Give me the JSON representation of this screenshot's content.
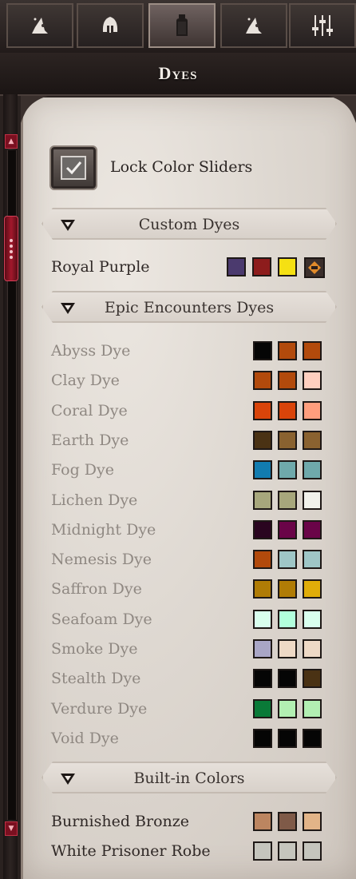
{
  "header": {
    "title": "Dyes"
  },
  "tabs": [
    {
      "icon": "wizard-hat-icon"
    },
    {
      "icon": "helmet-icon"
    },
    {
      "icon": "dye-bottle-icon",
      "active": true
    },
    {
      "icon": "wizard-hat-icon"
    },
    {
      "icon": "sliders-icon"
    }
  ],
  "lock": {
    "label": "Lock Color Sliders",
    "checked": true
  },
  "sections": {
    "custom": "Custom Dyes",
    "epic": "Epic Encounters Dyes",
    "builtin": "Built-in Colors"
  },
  "custom_dyes": [
    {
      "name": "Royal Purple",
      "colors": [
        "#4b3a6e",
        "#8d1c1c",
        "#f5e013"
      ]
    }
  ],
  "epic_dyes": [
    {
      "name": "Abyss Dye",
      "colors": [
        "#050505",
        "#b24a0c",
        "#b24a0c"
      ]
    },
    {
      "name": "Clay Dye",
      "colors": [
        "#b24a0c",
        "#b24a0c",
        "#ffcfbf"
      ]
    },
    {
      "name": "Coral Dye",
      "colors": [
        "#d9440a",
        "#d9440a",
        "#ff9e7d"
      ]
    },
    {
      "name": "Earth Dye",
      "colors": [
        "#4a3214",
        "#8a6230",
        "#8a6230"
      ]
    },
    {
      "name": "Fog Dye",
      "colors": [
        "#127cb0",
        "#6fa9ab",
        "#6fa9ab"
      ]
    },
    {
      "name": "Lichen Dye",
      "colors": [
        "#a7a77c",
        "#a7a77c",
        "#f1f1eb"
      ]
    },
    {
      "name": "Midnight Dye",
      "colors": [
        "#2a0520",
        "#6a0448",
        "#6a0448"
      ]
    },
    {
      "name": "Nemesis Dye",
      "colors": [
        "#b24a0c",
        "#9fc6c6",
        "#9fc6c6"
      ]
    },
    {
      "name": "Saffron Dye",
      "colors": [
        "#b07c06",
        "#b07c06",
        "#e0ad09"
      ]
    },
    {
      "name": "Seafoam Dye",
      "colors": [
        "#d9ffee",
        "#b2ffdc",
        "#d9ffee"
      ]
    },
    {
      "name": "Smoke Dye",
      "colors": [
        "#a9a6c6",
        "#eed9c6",
        "#eed9c6"
      ]
    },
    {
      "name": "Stealth Dye",
      "colors": [
        "#050505",
        "#050505",
        "#4a3214"
      ]
    },
    {
      "name": "Verdure Dye",
      "colors": [
        "#0a7a38",
        "#b2efb2",
        "#b2efb2"
      ]
    },
    {
      "name": "Void Dye",
      "colors": [
        "#050505",
        "#050505",
        "#050505"
      ]
    }
  ],
  "builtin_colors": [
    {
      "name": "Burnished Bronze",
      "colors": [
        "#bc8560",
        "#7f5a48",
        "#e2b488"
      ]
    },
    {
      "name": "White Prisoner Robe",
      "colors": [
        "#c5c5bd",
        "#c5c5bd",
        "#c5c5bd"
      ]
    }
  ]
}
